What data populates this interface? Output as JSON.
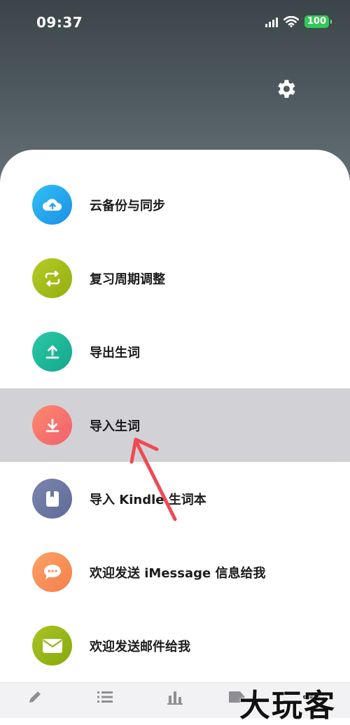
{
  "status_bar": {
    "time": "09:37",
    "battery": "100"
  },
  "menu": {
    "items": [
      {
        "label": "云备份与同步",
        "icon": "cloud-upload-icon",
        "color": "#2aa8f0"
      },
      {
        "label": "复习周期调整",
        "icon": "repeat-icon",
        "color": "#a4bd1a"
      },
      {
        "label": "导出生词",
        "icon": "export-icon",
        "color": "#1fb79a"
      },
      {
        "label": "导入生词",
        "icon": "import-icon",
        "color": "#f4766a"
      },
      {
        "label": "导入 Kindle 生词本",
        "icon": "kindle-book-icon",
        "color": "#6e7aa6"
      },
      {
        "label": "欢迎发送 iMessage 信息给我",
        "icon": "message-icon",
        "color": "#f7925a"
      },
      {
        "label": "欢迎发送邮件给我",
        "icon": "mail-icon",
        "color": "#97b81a"
      }
    ]
  },
  "tabbar": {
    "tabs": [
      {
        "icon": "pencil-icon"
      },
      {
        "icon": "list-icon"
      },
      {
        "icon": "bar-chart-icon"
      },
      {
        "icon": "tag-icon"
      },
      {
        "icon": "more-icon"
      }
    ]
  },
  "watermark": {
    "text": "大玩客"
  }
}
